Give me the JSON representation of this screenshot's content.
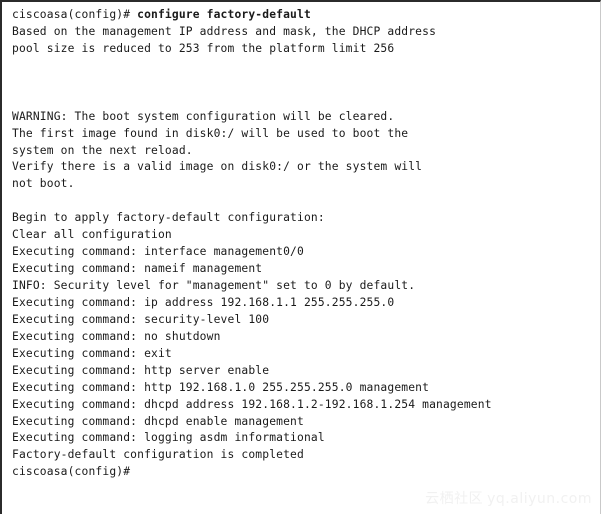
{
  "terminal": {
    "prompt": "ciscoasa(config)#",
    "entered_command": "configure factory-default",
    "final_prompt": "ciscoasa(config)#",
    "lines": [
      {
        "type": "prompt",
        "prompt": "ciscoasa(config)# ",
        "command": "configure factory-default"
      },
      {
        "type": "text",
        "text": "Based on the management IP address and mask, the DHCP address"
      },
      {
        "type": "text",
        "text": "pool size is reduced to 253 from the platform limit 256"
      },
      {
        "type": "blank",
        "text": ""
      },
      {
        "type": "blank",
        "text": ""
      },
      {
        "type": "blank",
        "text": ""
      },
      {
        "type": "text",
        "text": "WARNING: The boot system configuration will be cleared."
      },
      {
        "type": "text",
        "text": "The first image found in disk0:/ will be used to boot the"
      },
      {
        "type": "text",
        "text": "system on the next reload."
      },
      {
        "type": "text",
        "text": "Verify there is a valid image on disk0:/ or the system will"
      },
      {
        "type": "text",
        "text": "not boot."
      },
      {
        "type": "blank",
        "text": ""
      },
      {
        "type": "text",
        "text": "Begin to apply factory-default configuration:"
      },
      {
        "type": "text",
        "text": "Clear all configuration"
      },
      {
        "type": "text",
        "text": "Executing command: interface management0/0"
      },
      {
        "type": "text",
        "text": "Executing command: nameif management"
      },
      {
        "type": "text",
        "text": "INFO: Security level for \"management\" set to 0 by default."
      },
      {
        "type": "text",
        "text": "Executing command: ip address 192.168.1.1 255.255.255.0"
      },
      {
        "type": "text",
        "text": "Executing command: security-level 100"
      },
      {
        "type": "text",
        "text": "Executing command: no shutdown"
      },
      {
        "type": "text",
        "text": "Executing command: exit"
      },
      {
        "type": "text",
        "text": "Executing command: http server enable"
      },
      {
        "type": "text",
        "text": "Executing command: http 192.168.1.0 255.255.255.0 management"
      },
      {
        "type": "text",
        "text": "Executing command: dhcpd address 192.168.1.2-192.168.1.254 management"
      },
      {
        "type": "text",
        "text": "Executing command: dhcpd enable management"
      },
      {
        "type": "text",
        "text": "Executing command: logging asdm informational"
      },
      {
        "type": "text",
        "text": "Factory-default configuration is completed"
      },
      {
        "type": "text",
        "text": "ciscoasa(config)#"
      }
    ]
  },
  "watermark": {
    "chinese": "云栖社区",
    "url": "yq.aliyun.com"
  },
  "colors": {
    "background": "#ffffff",
    "text": "#1a1a1a",
    "border": "#2b2b2b",
    "watermark": "#f1f1f1"
  }
}
